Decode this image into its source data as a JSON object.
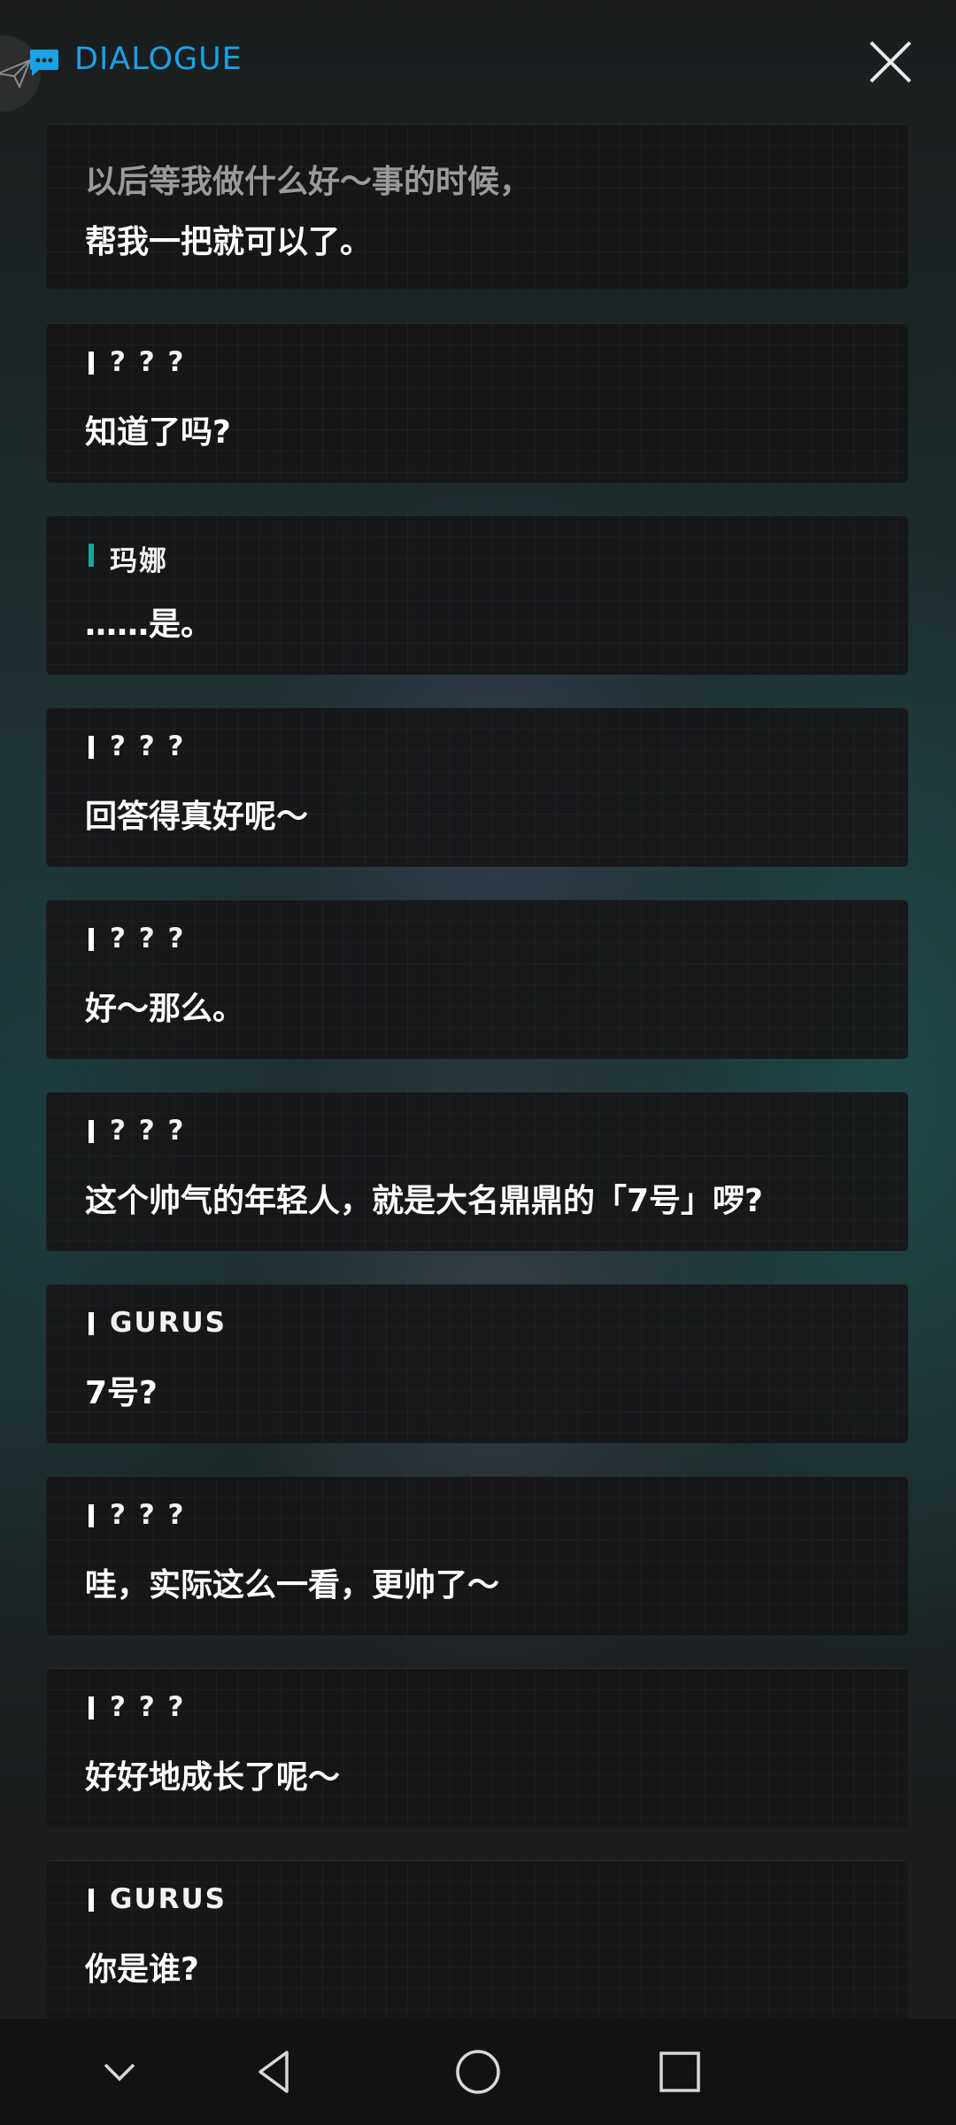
{
  "header": {
    "title": "DIALOGUE",
    "icon": "chat-bubble-icon",
    "close_icon": "close-icon",
    "accent_color": "#1aa2e6"
  },
  "dialogue": {
    "partial_entry": {
      "previous_line": "以后等我做什么好〜事的时候，",
      "line": "帮我一把就可以了。"
    },
    "entries": [
      {
        "speaker": "? ? ?",
        "line": "知道了吗?",
        "marker_color": "#ffffff"
      },
      {
        "speaker": "玛娜",
        "line": "……是。",
        "marker_color": "#19a79a"
      },
      {
        "speaker": "? ? ?",
        "line": "回答得真好呢〜",
        "marker_color": "#ffffff"
      },
      {
        "speaker": "? ? ?",
        "line": "好〜那么。",
        "marker_color": "#ffffff"
      },
      {
        "speaker": "? ? ?",
        "line": "这个帅气的年轻人，就是大名鼎鼎的「7号」啰?",
        "marker_color": "#ffffff"
      },
      {
        "speaker": "GURUS",
        "line": "7号?",
        "marker_color": "#ffffff"
      },
      {
        "speaker": "? ? ?",
        "line": "哇，实际这么一看，更帅了〜",
        "marker_color": "#ffffff"
      },
      {
        "speaker": "? ? ?",
        "line": "好好地成长了呢〜",
        "marker_color": "#ffffff"
      },
      {
        "speaker": "GURUS",
        "line": "你是谁?",
        "marker_color": "#ffffff"
      }
    ]
  },
  "navigation": {
    "items": [
      "chevron-down-icon",
      "back-triangle-icon",
      "home-circle-icon",
      "recents-square-icon"
    ]
  }
}
